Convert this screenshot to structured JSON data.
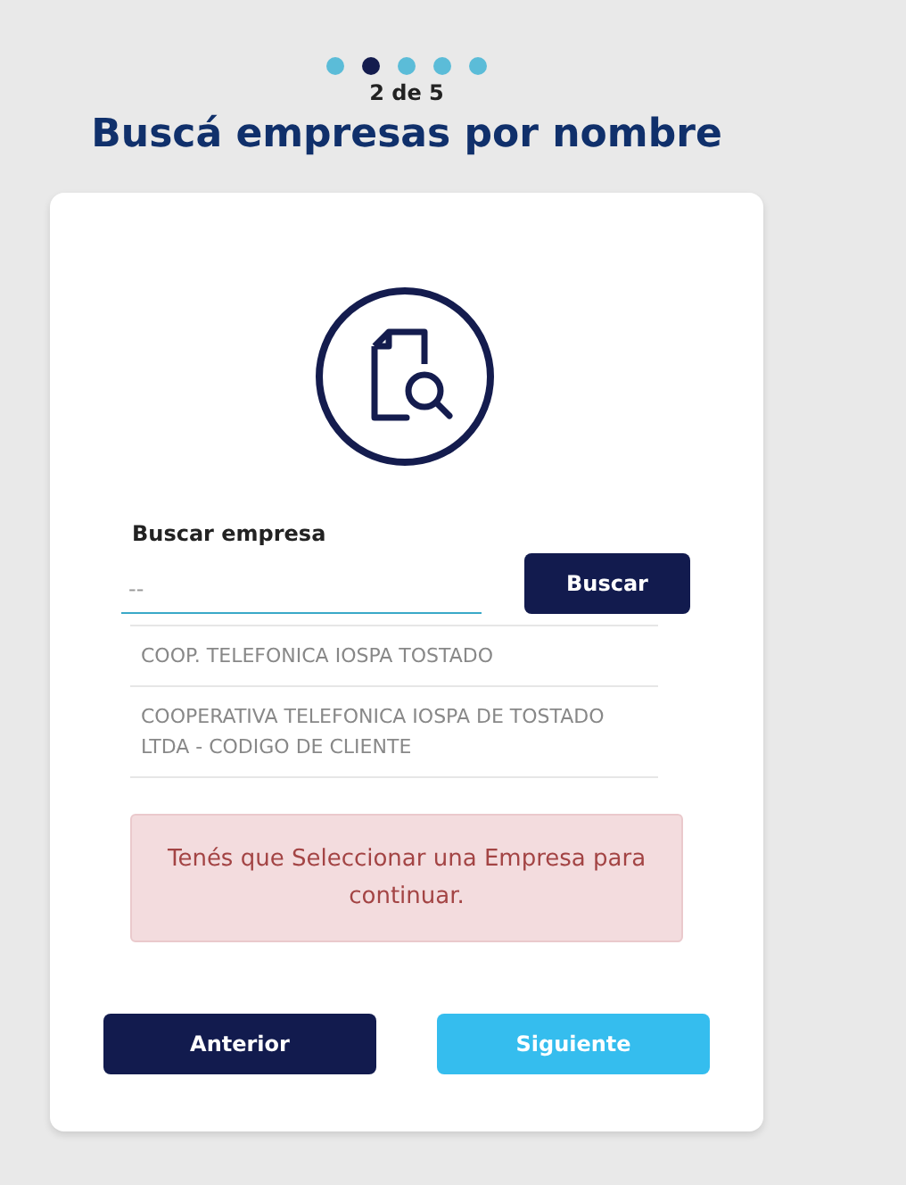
{
  "steps": [
    {
      "selected": false
    },
    {
      "selected": true
    },
    {
      "selected": false
    },
    {
      "selected": false
    },
    {
      "selected": false
    }
  ],
  "step_counter": "2 de 5",
  "title": "Buscá empresas por nombre",
  "search": {
    "label": "Buscar empresa",
    "placeholder": "--",
    "button": "Buscar"
  },
  "results": [
    "COOP. TELEFONICA IOSPA TOSTADO",
    "COOPERATIVA TELEFONICA IOSPA DE TOSTADO LTDA - CODIGO DE CLIENTE"
  ],
  "alert": "Tenés que Seleccionar una Empresa para continuar.",
  "buttons": [
    {
      "label": "Anterior",
      "kind": "secondary"
    },
    {
      "label": "Siguiente",
      "kind": "primary"
    }
  ]
}
